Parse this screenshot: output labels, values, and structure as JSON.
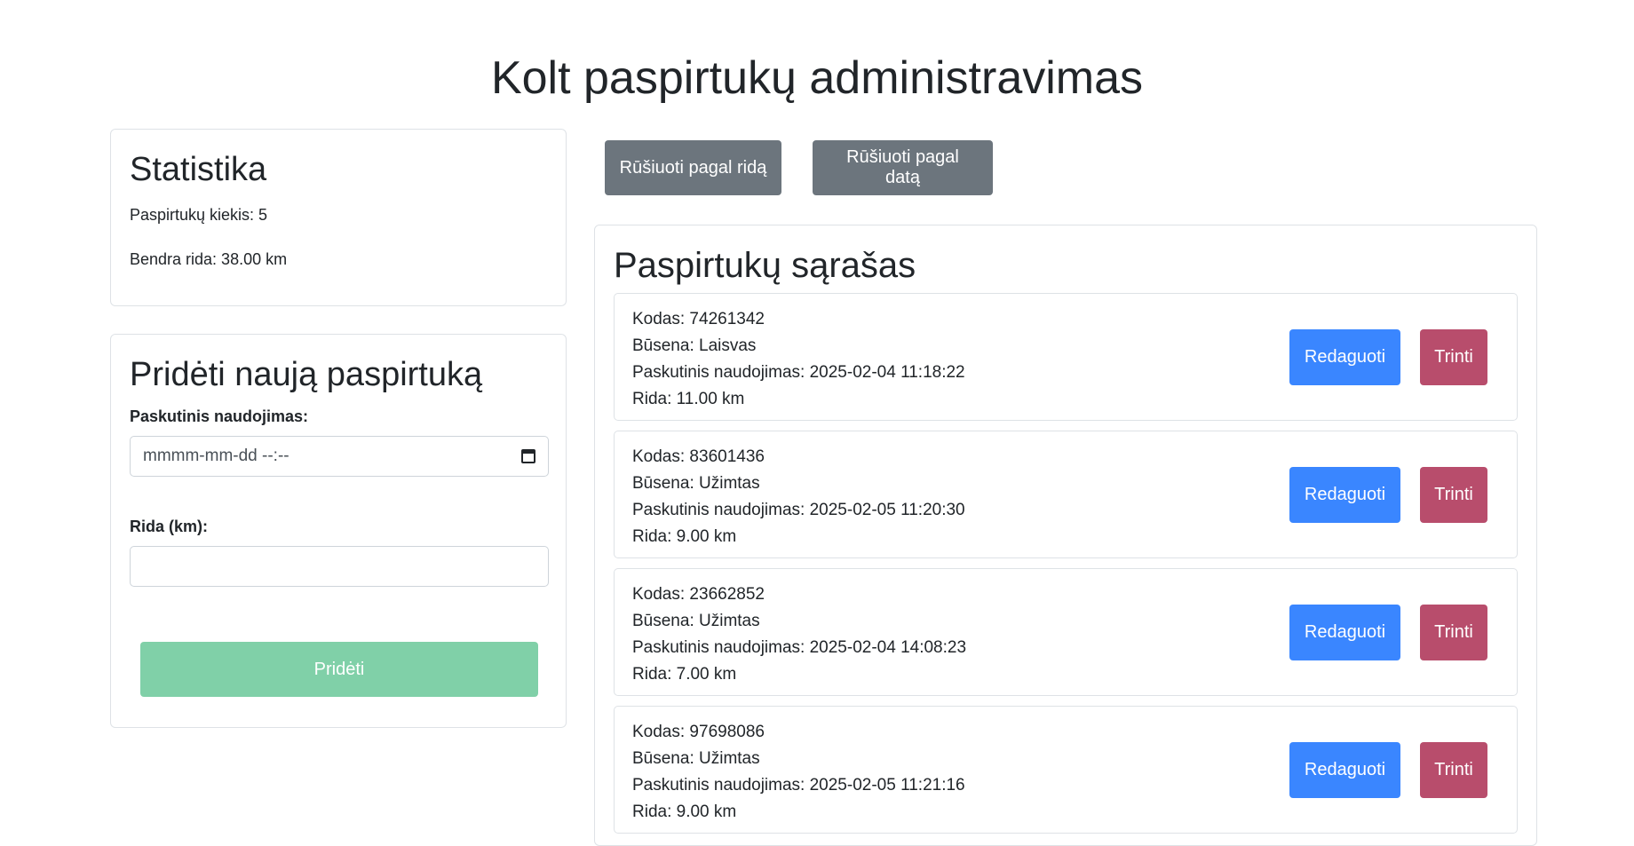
{
  "page_title": "Kolt paspirtukų administravimas",
  "statistics": {
    "title": "Statistika",
    "count_line": "Paspirtukų kiekis: 5",
    "mileage_line": "Bendra rida: 38.00 km"
  },
  "add_form": {
    "title": "Pridėti naują paspirtuką",
    "last_use_label": "Paskutinis naudojimas:",
    "last_use_placeholder": "mmmm-mm-dd --:--",
    "mileage_label": "Rida (km):",
    "mileage_value": "",
    "submit_label": "Pridėti"
  },
  "sort_buttons": {
    "by_mileage": "Rūšiuoti pagal ridą",
    "by_date": "Rūšiuoti pagal datą"
  },
  "list": {
    "title": "Paspirtukų sąrašas",
    "edit_label": "Redaguoti",
    "delete_label": "Trinti",
    "items": [
      {
        "code": "Kodas: 74261342",
        "status": "Būsena: Laisvas",
        "last_use": "Paskutinis naudojimas: 2025-02-04 11:18:22",
        "mileage": "Rida: 11.00 km"
      },
      {
        "code": "Kodas: 83601436",
        "status": "Būsena: Užimtas",
        "last_use": "Paskutinis naudojimas: 2025-02-05 11:20:30",
        "mileage": "Rida: 9.00 km"
      },
      {
        "code": "Kodas: 23662852",
        "status": "Būsena: Užimtas",
        "last_use": "Paskutinis naudojimas: 2025-02-04 14:08:23",
        "mileage": "Rida: 7.00 km"
      },
      {
        "code": "Kodas: 97698086",
        "status": "Būsena: Užimtas",
        "last_use": "Paskutinis naudojimas: 2025-02-05 11:21:16",
        "mileage": "Rida: 9.00 km"
      }
    ]
  },
  "colors": {
    "primary": "#3a86ff",
    "danger": "#b84d6c",
    "secondary": "#6c757d",
    "success_disabled": "#80d0a8"
  }
}
